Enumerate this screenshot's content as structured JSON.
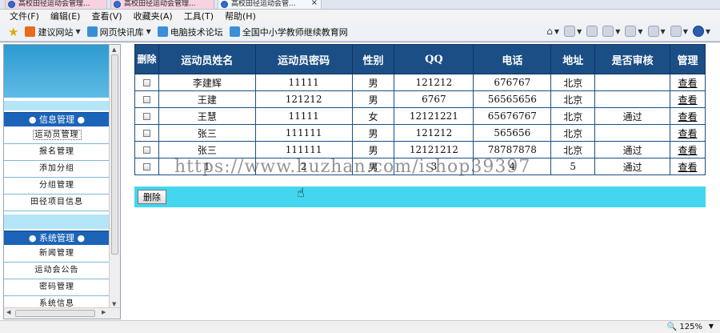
{
  "tabs": [
    {
      "label": "高校田径运动会管理..."
    },
    {
      "label": "高校田径运动会管理..."
    },
    {
      "label": "高校田径运动会管..."
    }
  ],
  "tab_close": "×",
  "menu": [
    "文件(F)",
    "编辑(E)",
    "查看(V)",
    "收藏夹(A)",
    "工具(T)",
    "帮助(H)"
  ],
  "favorites": [
    {
      "label": "建议网站",
      "color": "#e96b1e"
    },
    {
      "label": "网页快讯库",
      "color": "#3a8fd6"
    },
    {
      "label": "电脑技术论坛",
      "color": "#3a8fd6"
    },
    {
      "label": "全国中小学教师继续教育网",
      "color": "#3a8fd6"
    }
  ],
  "sidebar": {
    "sections": [
      {
        "title": "● 信息管理 ●",
        "items": [
          "运动员管理",
          "报名管理",
          "添加分组",
          "分组管理",
          "田径项目信息"
        ]
      },
      {
        "title": "● 系统管理 ●",
        "items": [
          "新闻管理",
          "运动会公告",
          "密码管理",
          "系统信息"
        ]
      }
    ]
  },
  "table": {
    "headers": [
      "删除",
      "运动员姓名",
      "运动员密码",
      "性别",
      "QQ",
      "电话",
      "地址",
      "是否审核",
      "管理"
    ],
    "rows": [
      {
        "name": "李建辉",
        "password": "11111",
        "gender": "男",
        "qq": "121212",
        "phone": "676767",
        "address": "北京",
        "approved": "",
        "action": "查看"
      },
      {
        "name": "王建",
        "password": "121212",
        "gender": "男",
        "qq": "6767",
        "phone": "56565656",
        "address": "北京",
        "approved": "",
        "action": "查看"
      },
      {
        "name": "王慧",
        "password": "11111",
        "gender": "女",
        "qq": "12121221",
        "phone": "65676767",
        "address": "北京",
        "approved": "通过",
        "action": "查看"
      },
      {
        "name": "张三",
        "password": "111111",
        "gender": "男",
        "qq": "121212",
        "phone": "565656",
        "address": "北京",
        "approved": "",
        "action": "查看"
      },
      {
        "name": "张三",
        "password": "111111",
        "gender": "男",
        "qq": "12121212",
        "phone": "78787878",
        "address": "北京",
        "approved": "通过",
        "action": "查看"
      },
      {
        "name": "1",
        "password": "2",
        "gender": "男",
        "qq": "3",
        "phone": "4",
        "address": "5",
        "approved": "通过",
        "action": "查看"
      }
    ]
  },
  "delete_button": "删除",
  "watermark": "https://www.huzhan.com/ishop39397",
  "status": {
    "zoom": "125%"
  }
}
